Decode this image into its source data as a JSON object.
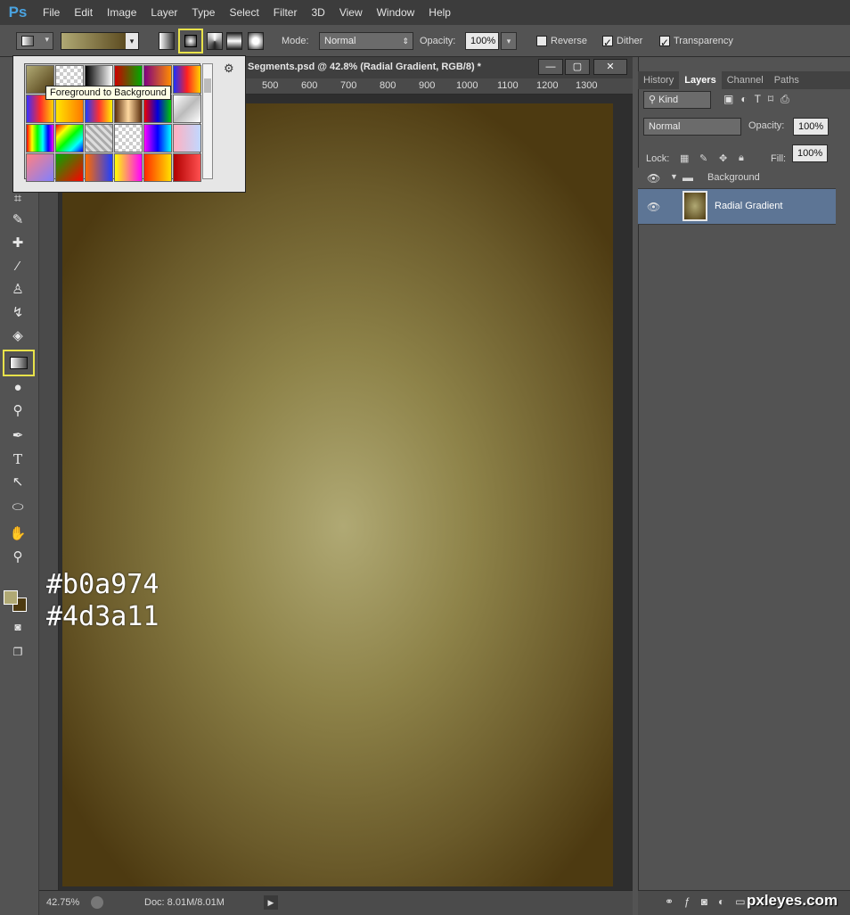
{
  "app": {
    "logo": "Ps"
  },
  "menubar": {
    "items": [
      "File",
      "Edit",
      "Image",
      "Layer",
      "Type",
      "Select",
      "Filter",
      "3D",
      "View",
      "Window",
      "Help"
    ]
  },
  "optionsbar": {
    "mode_label": "Mode:",
    "mode_value": "Normal",
    "opacity_label": "Opacity:",
    "opacity_value": "100%",
    "reverse_label": "Reverse",
    "reverse_checked": false,
    "dither_label": "Dither",
    "dither_checked": true,
    "transparency_label": "Transparency",
    "transparency_checked": true,
    "gradient_type_selected": "radial"
  },
  "gradient_picker": {
    "tooltip": "Foreground to Background",
    "swatches": [
      "linear-gradient(135deg,#b0a974,#4d3a11)",
      "repeating-conic-gradient(#fff 0 25%,#ccc 0 50%) 0/8px 8px",
      "linear-gradient(90deg,#000,#fff)",
      "linear-gradient(90deg,#c00,#0a0)",
      "linear-gradient(90deg,#800080,#ff8c00)",
      "linear-gradient(90deg,#1a2fff,#ff2020,#ffd400)",
      "linear-gradient(90deg,#3a2fff,#ff2a2a,#ffd400)",
      "linear-gradient(90deg,#ffe600,#ff7700)",
      "linear-gradient(90deg,#1c3cff,#ff3030,#fff200)",
      "linear-gradient(90deg,#5a2d0c,#ffd9a0,#5a2d0c)",
      "linear-gradient(90deg,#e00,#00d,#0c0)",
      "linear-gradient(135deg,#fff,#bbb,#fff)",
      "linear-gradient(90deg,#f00,#ff0,#0f0,#0ff,#00f,#f0f)",
      "linear-gradient(135deg,#f00,#ff0,#0f0,#0ff,#00f)",
      "repeating-linear-gradient(45deg,#ddd 0 3px,#aaa 3px 6px)",
      "repeating-conic-gradient(#fff 0 25%,#ccc 0 50%) 0/8px 8px",
      "linear-gradient(90deg,#f0f,#00f,#0ff)",
      "linear-gradient(90deg,#ffb0c0,#c0d8ff)",
      "linear-gradient(135deg,#ff8080,#8080ff)",
      "linear-gradient(135deg,#0a0,#f00)",
      "linear-gradient(90deg,#ff6a00,#1e40ff)",
      "linear-gradient(90deg,#ffff00,#ff00ff)",
      "linear-gradient(90deg,#ff2a00,#ffe000)",
      "linear-gradient(90deg,#b00000,#ff5050)"
    ]
  },
  "document": {
    "tab_title": "Segments.psd @ 42.8% (Radial Gradient, RGB/8) *",
    "ruler_marks": [
      "500",
      "600",
      "700",
      "800",
      "900",
      "1000",
      "1100",
      "1200",
      "1300"
    ],
    "annotation_line1": "#b0a974",
    "annotation_line2": "#4d3a11",
    "zoom": "42.75%",
    "doc_info": "Doc: 8.01M/8.01M",
    "gradient_inner": "#b0a974",
    "gradient_outer": "#4d3a11"
  },
  "panel": {
    "tabs": [
      "History",
      "Layers",
      "Channel",
      "Paths"
    ],
    "active_tab": "Layers",
    "kind_label": "Kind",
    "blend_mode": "Normal",
    "opacity_label": "Opacity:",
    "opacity_value": "100%",
    "lock_label": "Lock:",
    "fill_label": "Fill:",
    "fill_value": "100%",
    "group_name": "Background",
    "layer_name": "Radial Gradient"
  },
  "watermark": "pxleyes.com"
}
